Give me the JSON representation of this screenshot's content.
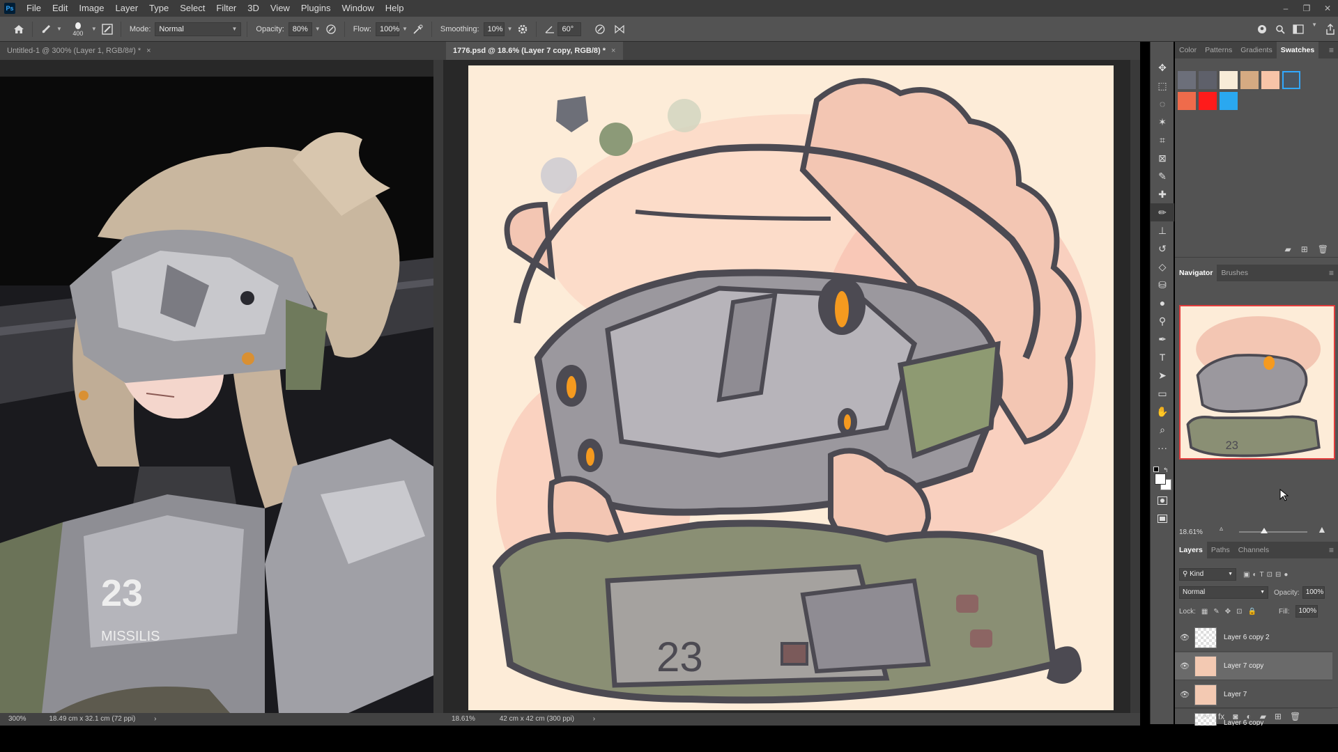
{
  "app": {
    "logo": "Ps"
  },
  "menu": [
    "File",
    "Edit",
    "Image",
    "Layer",
    "Type",
    "Select",
    "Filter",
    "3D",
    "View",
    "Plugins",
    "Window",
    "Help"
  ],
  "window_controls": {
    "minimize": "–",
    "restore": "❐",
    "close": "✕"
  },
  "options_bar": {
    "brush_size": "400",
    "mode_label": "Mode:",
    "mode_value": "Normal",
    "opacity_label": "Opacity:",
    "opacity_value": "80%",
    "flow_label": "Flow:",
    "flow_value": "100%",
    "smoothing_label": "Smoothing:",
    "smoothing_value": "10%",
    "angle_value": "60°"
  },
  "documents": [
    {
      "title": "Untitled-1 @ 300% (Layer 1, RGB/8#) *",
      "zoom": "300%",
      "size": "18.49 cm x 32.1 cm (72 ppi)",
      "active": false
    },
    {
      "title": "1776.psd @ 18.6% (Layer 7 copy, RGB/8) *",
      "zoom": "18.61%",
      "size": "42 cm x 42 cm (300 ppi)",
      "active": true
    }
  ],
  "close_glyph": "×",
  "status_arrow": "›",
  "swatches_panel": {
    "tabs": [
      "Color",
      "Patterns",
      "Gradients",
      "Swatches"
    ],
    "active_tab": "Swatches",
    "colors": [
      "#6c6f7a",
      "#5e606a",
      "#f8ecd8",
      "#d5aa82",
      "#f7c4a8",
      "#4b5560",
      "#ef6b4b",
      "#ff1b1b",
      "#2aa8f0"
    ],
    "selected_index": 5
  },
  "navigator_panel": {
    "tabs": [
      "Navigator",
      "Brushes"
    ],
    "active_tab": "Navigator",
    "zoom": "18.61%"
  },
  "layers_panel": {
    "tabs": [
      "Layers",
      "Paths",
      "Channels"
    ],
    "active_tab": "Layers",
    "filter_kind": "Kind",
    "blend_mode": "Normal",
    "opacity_label": "Opacity:",
    "opacity_value": "100%",
    "lock_label": "Lock:",
    "fill_label": "Fill:",
    "fill_value": "100%",
    "layers": [
      {
        "name": "Layer 6 copy 2",
        "visible": true,
        "selected": false,
        "thumb": "transparent"
      },
      {
        "name": "Layer 7 copy",
        "visible": true,
        "selected": true,
        "thumb": "art"
      },
      {
        "name": "Layer 7",
        "visible": true,
        "selected": false,
        "thumb": "art"
      },
      {
        "name": "Layer 6 copy",
        "visible": false,
        "selected": false,
        "thumb": "transparent"
      }
    ]
  },
  "tools": [
    "move-tool",
    "marquee-tool",
    "lasso-tool",
    "magic-wand-tool",
    "crop-tool",
    "frame-tool",
    "eyedropper-tool",
    "healing-brush-tool",
    "brush-tool",
    "clone-stamp-tool",
    "history-brush-tool",
    "eraser-tool",
    "paint-bucket-tool",
    "blur-tool",
    "dodge-tool",
    "pen-tool",
    "type-tool",
    "path-selection-tool",
    "rectangle-tool",
    "hand-tool",
    "zoom-tool",
    "more-tools"
  ],
  "tool_glyphs": [
    "✥",
    "⬚",
    "◌",
    "✶",
    "⌗",
    "⊠",
    "✎",
    "✚",
    "✏",
    "⊥",
    "↺",
    "◇",
    "⛁",
    "●",
    "⚲",
    "✒",
    "T",
    "➤",
    "▭",
    "✋",
    "⌕",
    "···"
  ],
  "active_tool": "brush-tool",
  "colors": {
    "foreground": "#ffffff",
    "background": "#ffffff"
  }
}
